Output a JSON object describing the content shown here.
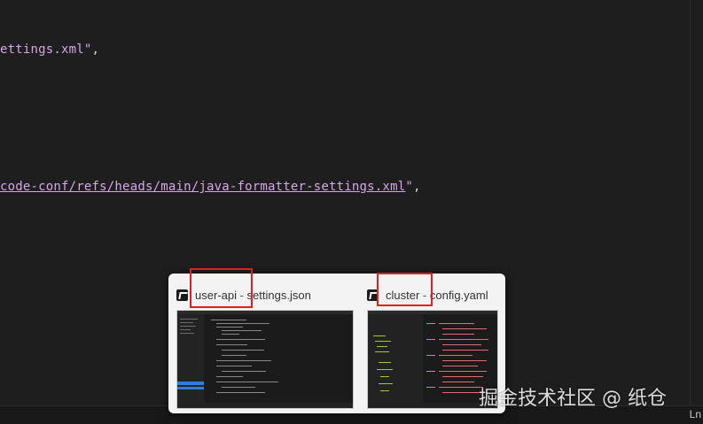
{
  "editor": {
    "line1_text": "ettings.xml\"",
    "line1_punc": ",",
    "line2_text": "code-conf/refs/heads/main/java-formatter-settings.xml",
    "line2_quote": "\"",
    "line2_punc": ","
  },
  "status_bar": {
    "position_label": "Ln"
  },
  "task_switcher": {
    "items": [
      {
        "project": "user-api",
        "separator": " - ",
        "file": "settings.json",
        "icon": "vscode-icon"
      },
      {
        "project": "cluster",
        "separator": " - ",
        "file": "config.yaml",
        "icon": "vscode-icon"
      }
    ]
  },
  "watermark": "掘金技术社区 @ 纸仓",
  "colors": {
    "string": "#d7a6e8",
    "highlight_box": "#e02020",
    "background": "#1e1e1e"
  }
}
